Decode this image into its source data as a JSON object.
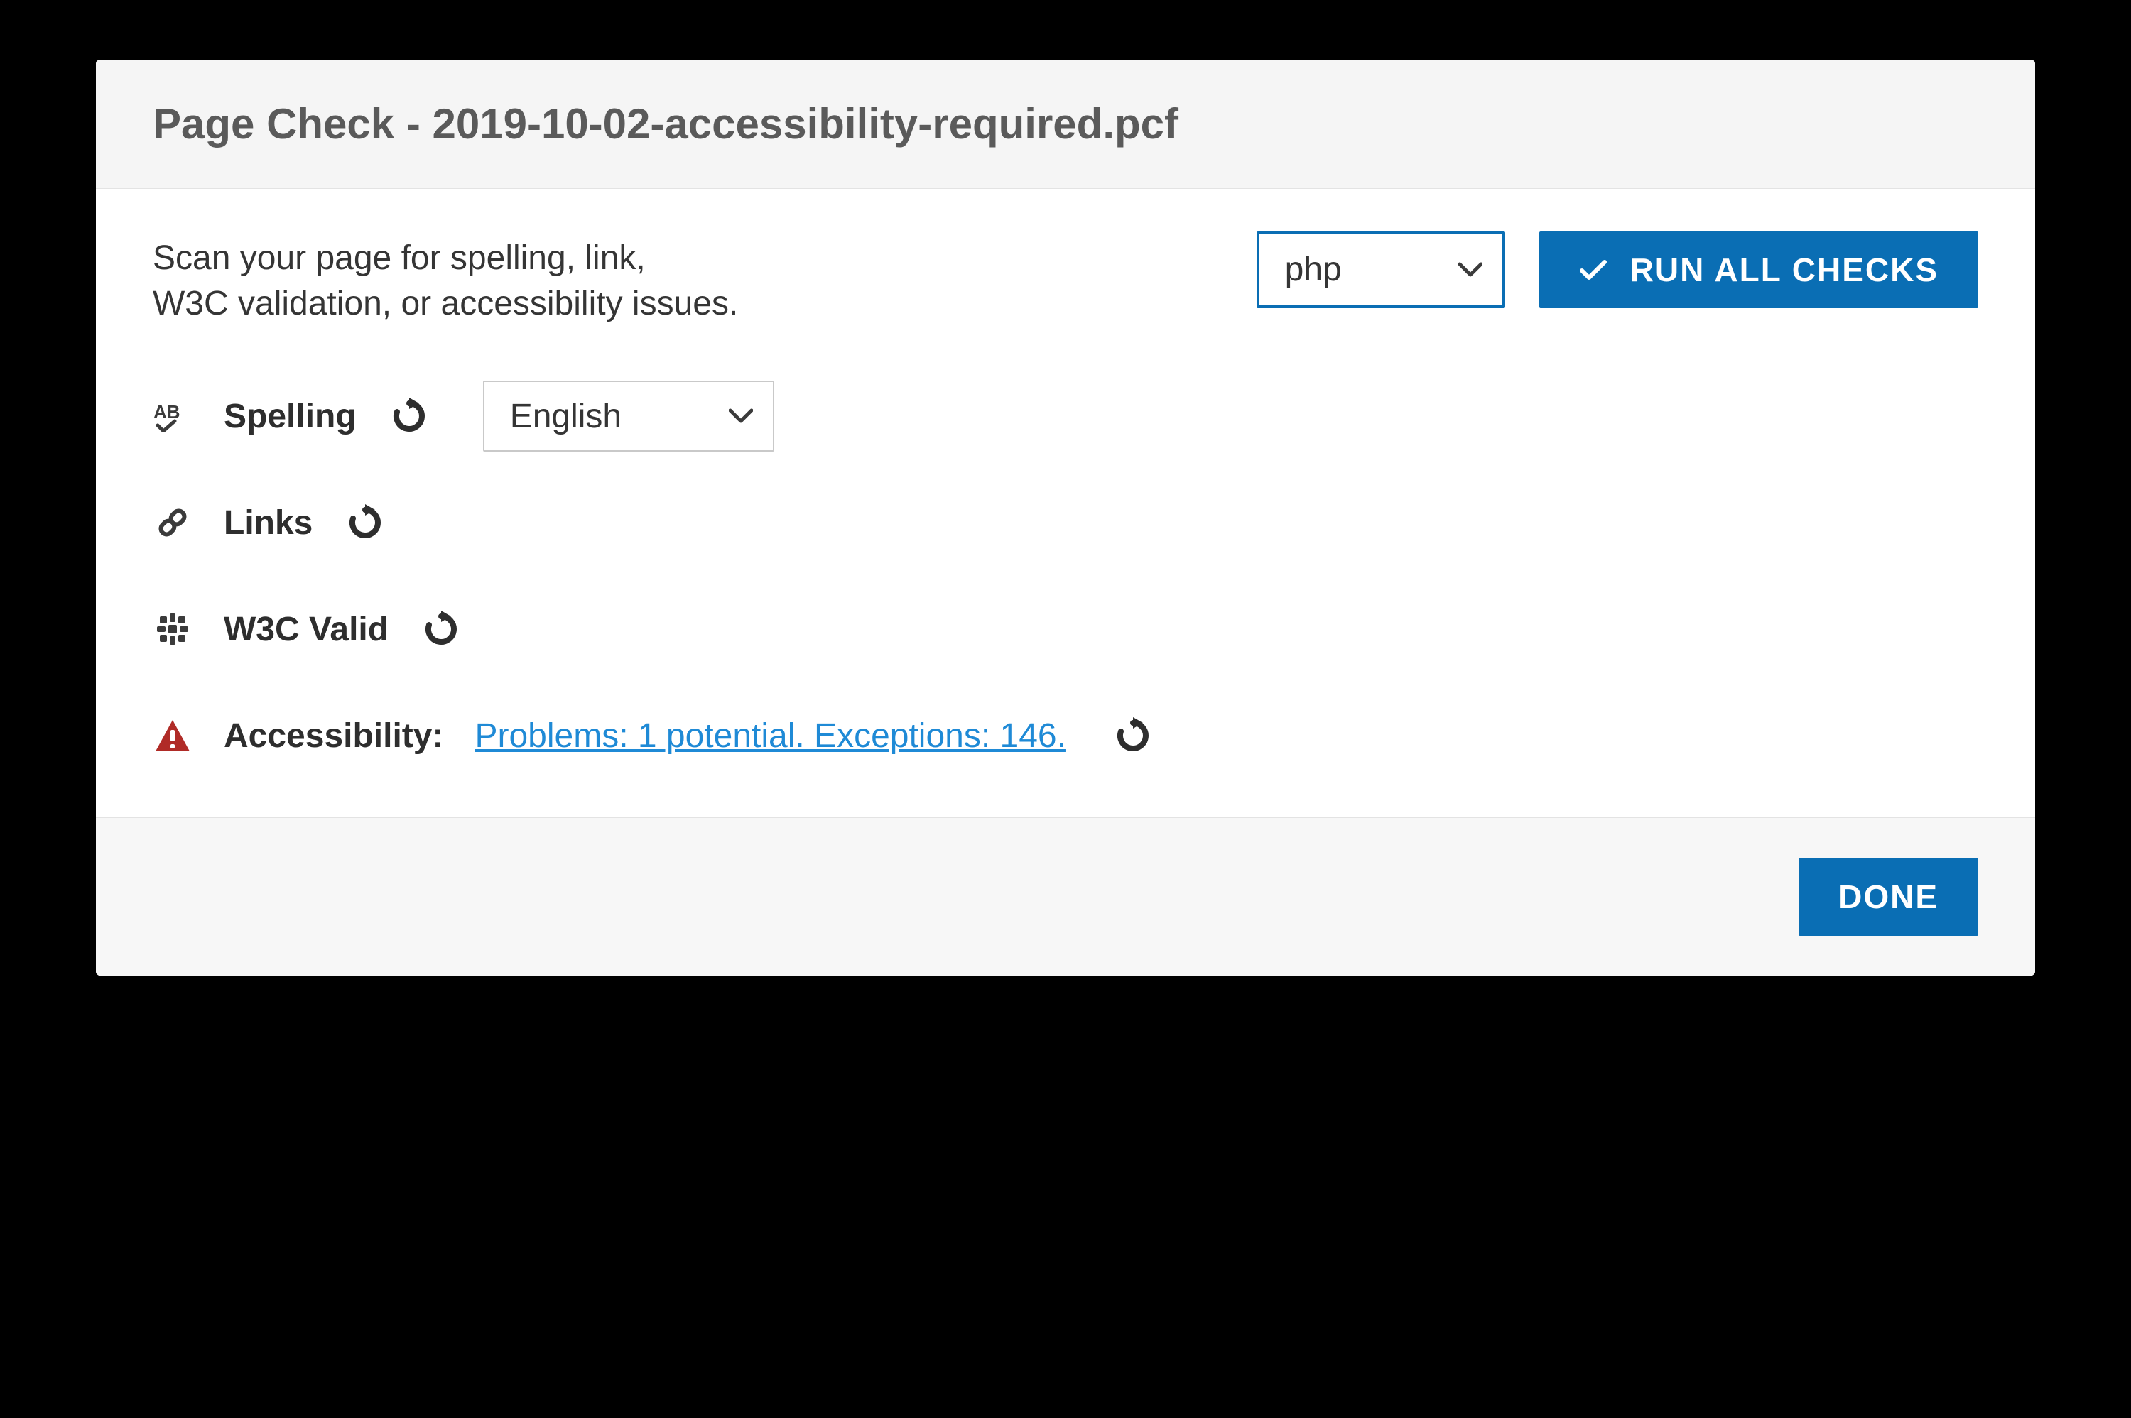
{
  "dialog": {
    "title": "Page Check - 2019-10-02-accessibility-required.pcf",
    "intro_line1": "Scan your page for spelling, link,",
    "intro_line2": "W3C validation, or accessibility issues."
  },
  "top": {
    "format_select_value": "php",
    "run_all_label": "Run All Checks"
  },
  "checks": {
    "spelling": {
      "label": "Spelling",
      "language_value": "English"
    },
    "links": {
      "label": "Links"
    },
    "w3c": {
      "label": "W3C Valid"
    },
    "accessibility": {
      "label": "Accessibility:",
      "result_text": "Problems: 1 potential. Exceptions: 146."
    }
  },
  "footer": {
    "done_label": "Done"
  },
  "colors": {
    "primary": "#0a6eb4",
    "link": "#1f8ad6",
    "danger": "#b02b27",
    "icon": "#3b3b3b"
  }
}
